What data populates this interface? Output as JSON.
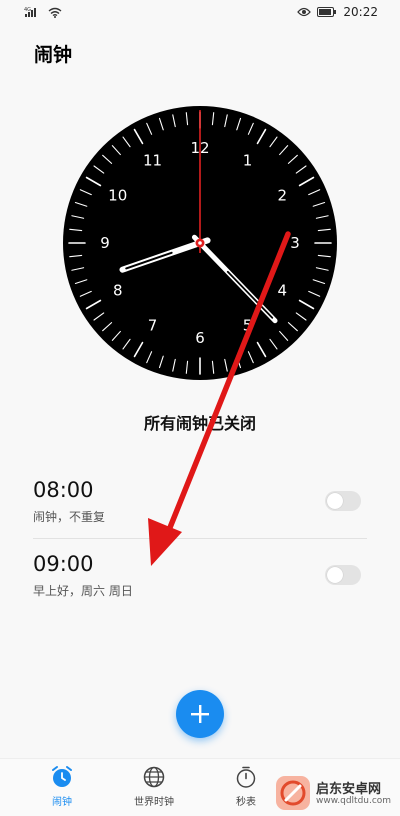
{
  "status_bar": {
    "signal_label": "4G",
    "time": "20:22",
    "icons": [
      "signal-icon",
      "wifi-icon",
      "eye-icon",
      "battery-icon"
    ]
  },
  "header": {
    "title": "闹钟"
  },
  "clock": {
    "numbers": [
      "12",
      "1",
      "2",
      "3",
      "4",
      "5",
      "6",
      "7",
      "8",
      "9",
      "10",
      "11"
    ],
    "hour_hand_color": "#ffffff",
    "second_hand_color": "#e02020",
    "face_color": "#000000"
  },
  "status_message": "所有闹钟已关闭",
  "alarms": [
    {
      "time": "08:00",
      "subtitle": "闹钟，不重复",
      "enabled": false
    },
    {
      "time": "09:00",
      "subtitle": "早上好，周六 周日",
      "enabled": false
    }
  ],
  "fab": {
    "icon": "plus-icon",
    "color": "#1a8cf0"
  },
  "bottom_nav": {
    "items": [
      {
        "label": "闹钟",
        "icon": "alarm-clock-icon",
        "active": true
      },
      {
        "label": "世界时钟",
        "icon": "globe-icon",
        "active": false
      },
      {
        "label": "秒表",
        "icon": "stopwatch-icon",
        "active": false
      }
    ]
  },
  "watermark": {
    "text": "启东安卓网",
    "url_text": "www.qdltdu.com"
  },
  "annotation": {
    "arrow_color": "#e01818"
  }
}
